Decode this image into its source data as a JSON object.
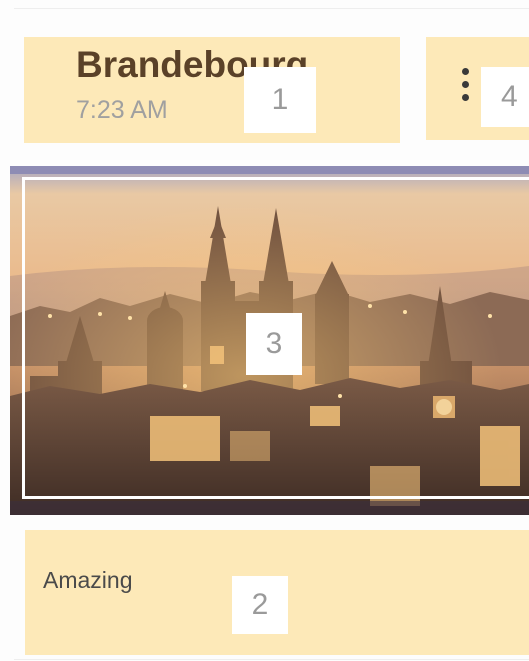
{
  "header": {
    "title": "Brandebourg",
    "time": "7:23 AM"
  },
  "menu": {
    "icon": "more-vert-icon"
  },
  "photo": {
    "description_icon": "city-photo"
  },
  "caption": {
    "text": "Amazing"
  },
  "badges": {
    "one": "1",
    "two": "2",
    "three": "3",
    "four": "4"
  },
  "colors": {
    "card_background": "#fde9b8",
    "title_color": "#5a4128",
    "time_color": "#a0a0a0"
  }
}
